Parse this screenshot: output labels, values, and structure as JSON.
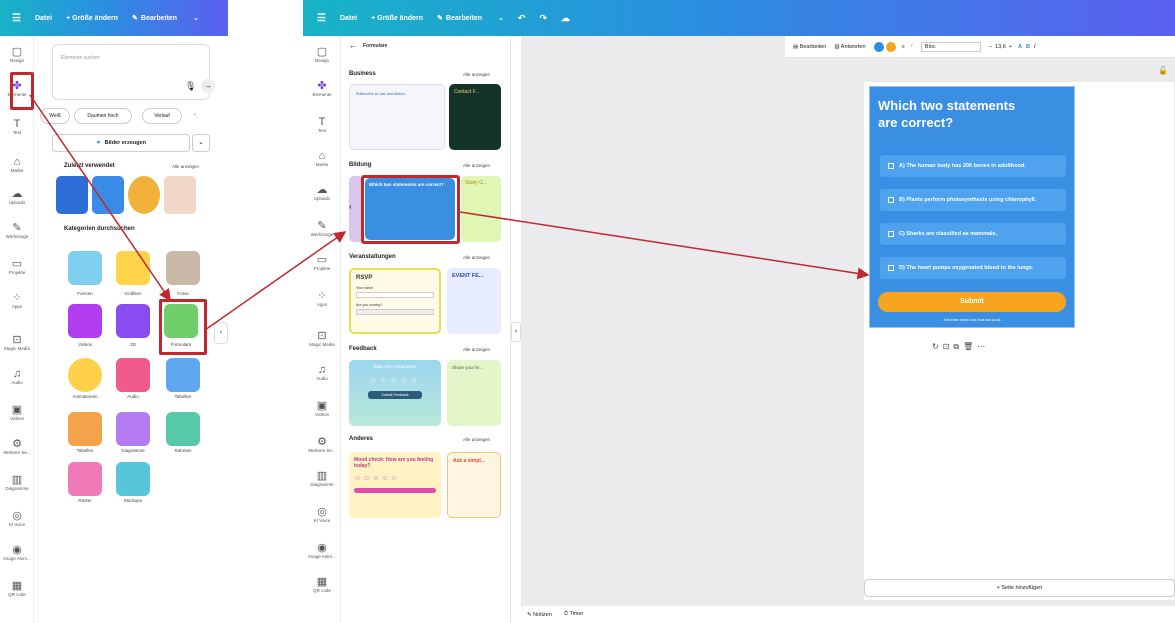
{
  "left": {
    "toolbar": {
      "file": "Datei",
      "resize": "+ Größe ändern",
      "edit": "Bearbeiten"
    },
    "rail": [
      "Design",
      "Elemente",
      "Text",
      "Marke",
      "Uploads",
      "Werkzeuge",
      "Projekte",
      "Apps",
      "Magic Media",
      "Audio",
      "Videos",
      "Mehrere Se...",
      "Diagramme",
      "KI Voice",
      "Image Anim...",
      "QR code"
    ],
    "search_placeholder": "Elemente suchen",
    "chips": [
      "Weiß",
      "Daumen hoch",
      "Verlauf"
    ],
    "generate": "Bilder erzeugen",
    "recent": "Zuletzt verwendet",
    "see_all": "Alle anzeigen",
    "categories_title": "Kategorien durchsuchen",
    "categories": [
      "Formen",
      "Grafiken",
      "Fotos",
      "Videos",
      "3D",
      "Formulare",
      "Animationen",
      "Audio",
      "Tabellen",
      "Tabellen",
      "Diagramme",
      "Rahmen",
      "Raster",
      "Mockups"
    ]
  },
  "mid": {
    "toolbar": {
      "file": "Datei",
      "resize": "+ Größe ändern",
      "edit": "Bearbeiten"
    },
    "back": "Formulare",
    "sections": [
      {
        "title": "Business",
        "all": "Alle anzeigen",
        "t1": "Subscribe to our newsletter",
        "t2": "Contact F..."
      },
      {
        "title": "Bildung",
        "all": "Alle anzeigen",
        "t1": "Which two statements are correct?",
        "t2": "Study G..."
      },
      {
        "title": "Veranstaltungen",
        "all": "Alle anzeigen",
        "t1": "RSVP",
        "t2": "EVENT FE..."
      },
      {
        "title": "Feedback",
        "all": "Alle anzeigen",
        "t1": "Rate your experience",
        "t2": "Share your fe..."
      },
      {
        "title": "Anderes",
        "all": "Alle anzeigen",
        "t1": "Mood check: How are you feeling today?",
        "t2": "Ask a simpl..."
      }
    ],
    "rsvp_name": "Your name",
    "rsvp_q": "Are you coming?",
    "feedback_btn": "Submit Feedback"
  },
  "editor": {
    "tools": {
      "edit": "Bearbeiten",
      "answers": "Antworten",
      "font": "Bloc",
      "size": "13,6"
    },
    "form_title": "Which two statements are correct?",
    "options": [
      "A) The human body has 206 bones in adulthood.",
      "B) Plants perform photosynthesis using chlorophyll.",
      "C) Sharks are classified as mammals.",
      "D) The heart pumps oxygenated blood to the lungs."
    ],
    "submit": "Submit",
    "footer": "See these steps how finds and pools",
    "add_page": "+ Seite hinzufügen",
    "notes": "Notizen",
    "timer": "Timer"
  },
  "colors": {
    "accent": "#2a8fe0",
    "form_bg": "#3b8fe3",
    "submit": "#f7a520",
    "highlight": "#c0282d"
  }
}
